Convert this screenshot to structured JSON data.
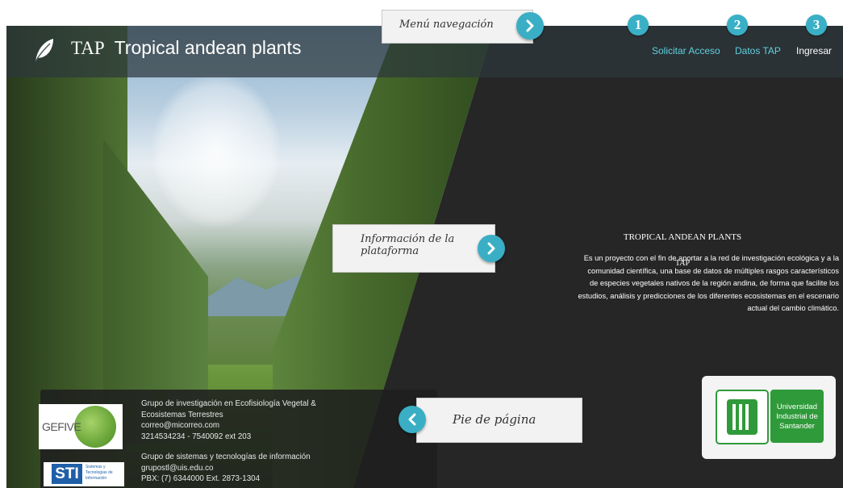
{
  "header": {
    "logo_abbr": "TAP",
    "logo_title": "Tropical andean plants"
  },
  "nav": {
    "items": [
      {
        "label": "Solicitar Acceso",
        "badge": "1",
        "color": "#5fd0e0"
      },
      {
        "label": "Datos TAP",
        "badge": "2",
        "color": "#5fd0e0"
      },
      {
        "label": "Ingresar",
        "badge": "3",
        "color": "#ffffff"
      }
    ]
  },
  "callouts": {
    "menu": "Menú navegación",
    "info_line1": "Información de la",
    "info_line2": "plataforma",
    "footer": "Pie de página"
  },
  "info": {
    "title": "TROPICAL ANDEAN PLANTS",
    "subtitle": "TAP",
    "lines": [
      "Es un proyecto con el fin de aportar a la red de investigación ecológica y a la",
      "comunidad científica, una base de datos de múltiples rasgos característicos",
      "de especies vegetales nativos de la región andina, de forma que facilite los",
      "estudios, análisis y predicciones de los diferentes ecosistemas en el escenario",
      "actual del cambio climático."
    ]
  },
  "footer": {
    "group1": {
      "name_line1": "Grupo de investigación en Ecofisiología Vegetal &",
      "name_line2": "Ecosistemas Terrestres",
      "email": "correo@micorreo.com",
      "phone": "3214534234 - 7540092 ext 203"
    },
    "group2": {
      "name": "Grupo de sistemas y tecnologías de información",
      "email": "grupostl@uis.edu.co",
      "phone": "PBX: (7) 6344000 Ext. 2873-1304"
    },
    "gefive_logo_text": "GEFIVE",
    "sti_logo_text": "STI",
    "sti_logo_sub1": "Sistemas y",
    "sti_logo_sub2": "Tecnologías de",
    "sti_logo_sub3": "Información"
  },
  "university": {
    "line1": "Universidad",
    "line2": "Industrial de",
    "line3": "Santander",
    "mark": "UIS"
  },
  "colors": {
    "accent": "#3ab0c6",
    "uis_green": "#2f9a3a",
    "nav_link": "#5fd0e0"
  }
}
